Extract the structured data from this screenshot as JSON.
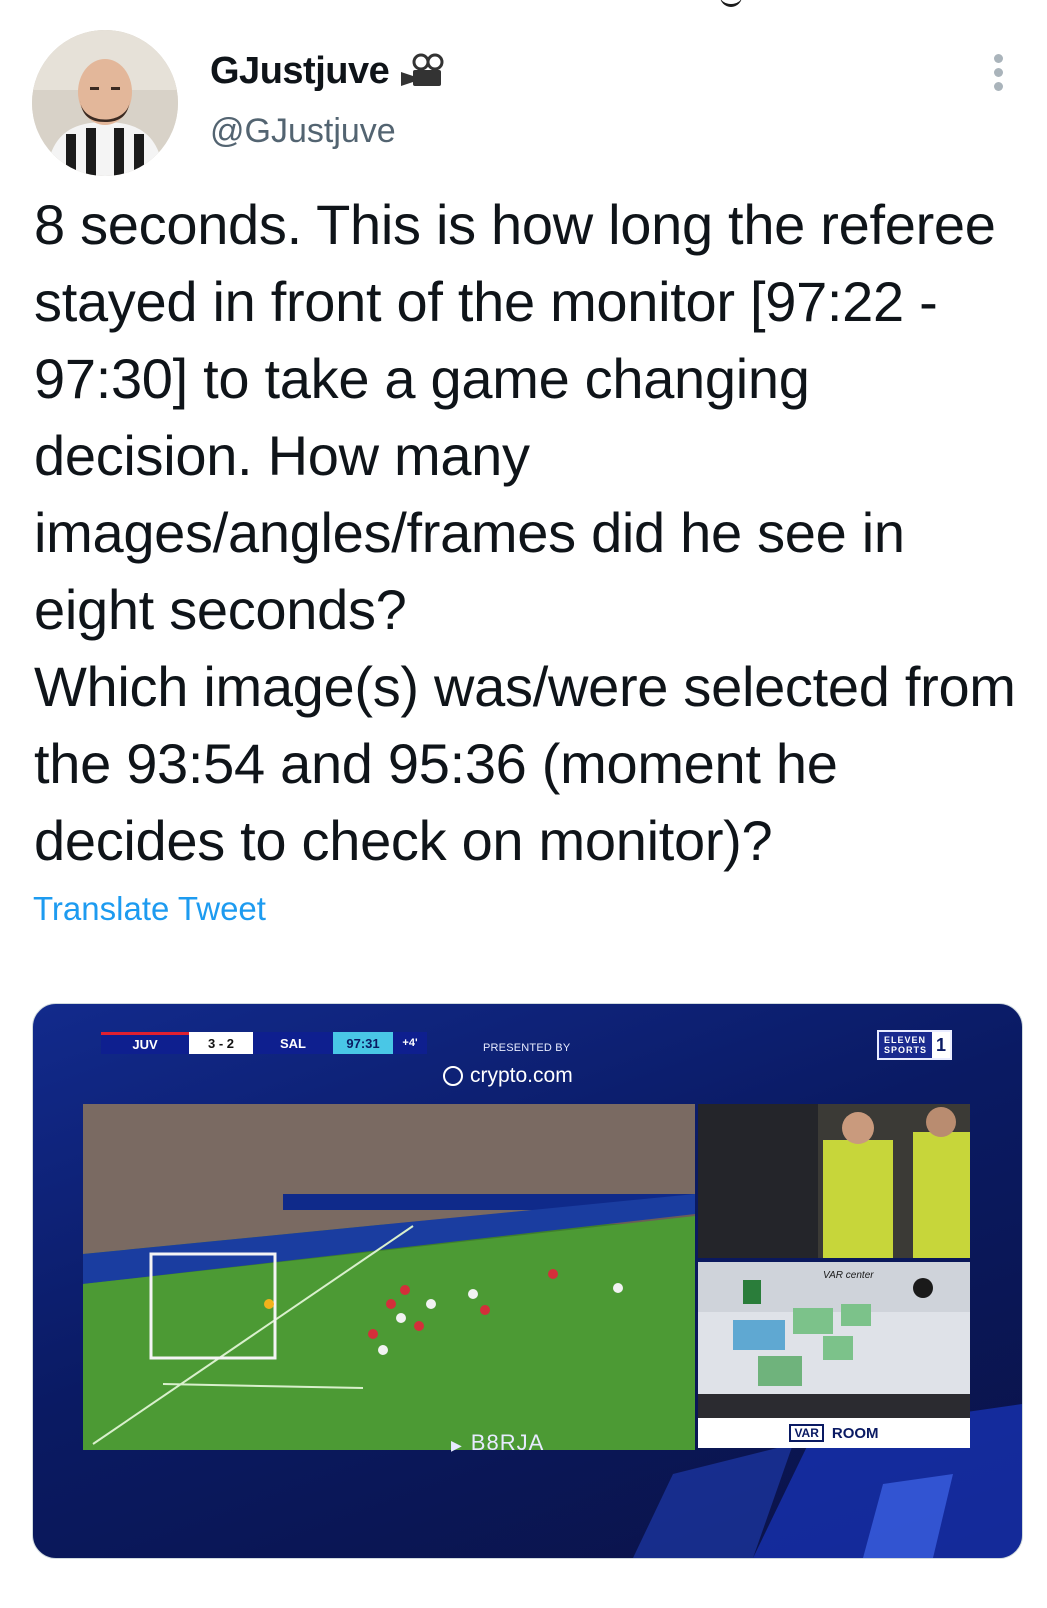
{
  "tweet": {
    "display_name": "GJustjuve",
    "handle": "@GJustjuve",
    "name_emoji": "movie-camera-icon",
    "text": "8 seconds. This is how long the referee stayed in front of the monitor [97:22 - 97:30] to take a game changing decision. How many images/angles/frames did he see in eight seconds?\nWhich image(s) was/were selected from the 93:54 and 95:36 (moment he decides to check on monitor)?",
    "translate_label": "Translate Tweet"
  },
  "media": {
    "scorebug": {
      "home": "JUV",
      "score": "3 - 2",
      "away": "SAL",
      "clock": "97:31",
      "added_time": "+4'"
    },
    "sponsor_label": "PRESENTED BY",
    "sponsor_name": "crypto.com",
    "channel": {
      "name_line1": "ELEVEN",
      "name_line2": "SPORTS",
      "number": "1"
    },
    "var_badge": "VAR",
    "room_label": "ROOM",
    "watermark": "B8RJA",
    "var_center_text": "VAR center"
  },
  "colors": {
    "link": "#1d9bf0",
    "text_primary": "#0f1419",
    "text_secondary": "#536471",
    "broadcast_blue": "#0e1f8f",
    "clock_cyan": "#49c7e6"
  }
}
